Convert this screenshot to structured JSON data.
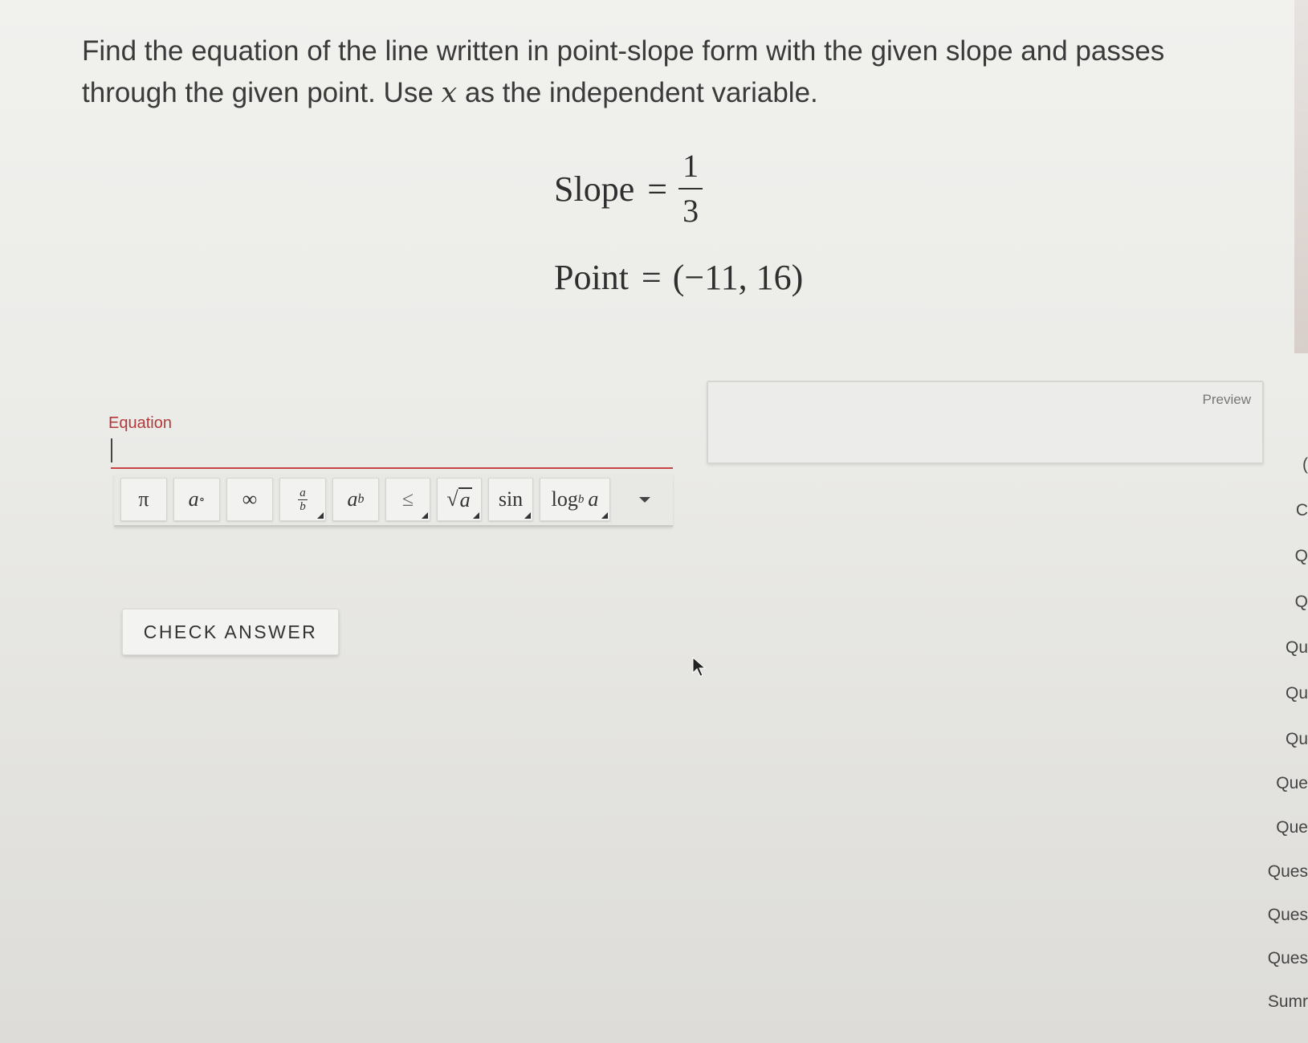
{
  "question": {
    "text_before_var": "Find the equation of the line written in point-slope form with the given slope and passes through the given point. Use ",
    "variable": "x",
    "text_after_var": " as the independent variable."
  },
  "given": {
    "slope_label": "Slope",
    "equals": "=",
    "slope_numerator": "1",
    "slope_denominator": "3",
    "point_label": "Point",
    "point_value": "(−11, 16)"
  },
  "answer": {
    "label": "Equation",
    "value": "",
    "preview_label": "Preview"
  },
  "toolbar": {
    "pi": "π",
    "degree_base": "a",
    "degree_sup": "∘",
    "infinity": "∞",
    "frac_num": "a",
    "frac_den": "b",
    "power_base": "a",
    "power_exp": "b",
    "leq": "≤",
    "sqrt_symbol": "√",
    "sqrt_radicand": "a",
    "sin": "sin",
    "log": "log",
    "log_base": "b",
    "log_arg": "a"
  },
  "buttons": {
    "check_answer": "CHECK ANSWER"
  },
  "side_nav": {
    "items": [
      "(",
      "C",
      "Q",
      "Q",
      "Qu",
      "Qu",
      "Qu",
      "Que",
      "Que",
      "Ques",
      "Ques",
      "Ques",
      "Sumr"
    ]
  }
}
